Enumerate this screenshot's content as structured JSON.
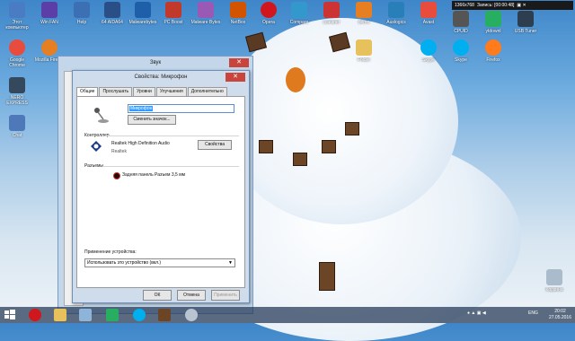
{
  "desktop_icons": [
    {
      "label": "Этот компьютер",
      "color": "#4a7cc4"
    },
    {
      "label": "Win FAN",
      "color": "#5b3ea8"
    },
    {
      "label": "Help",
      "color": "#3d6fb5"
    },
    {
      "label": "64 AIDA64",
      "color": "#2a4f86"
    },
    {
      "label": "Malwarebytes",
      "color": "#1f5ea8"
    },
    {
      "label": "PC Boost",
      "color": "#c0392b"
    },
    {
      "label": "Malware Bytes",
      "color": "#9b59b6"
    },
    {
      "label": "NetBox",
      "color": "#d35400"
    },
    {
      "label": "Opera",
      "color": "#d1171e"
    },
    {
      "label": "Compare",
      "color": "#3399cc"
    },
    {
      "label": "ccleaner",
      "color": "#cc3333"
    },
    {
      "label": "demo",
      "color": "#e67e22"
    },
    {
      "label": "Auslogics",
      "color": "#2980b9"
    },
    {
      "label": "Avast",
      "color": "#e74c3c"
    },
    {
      "label": "CPUID",
      "color": "#555555"
    },
    {
      "label": "ytdownl",
      "color": "#27ae60"
    },
    {
      "label": "USB Tuner",
      "color": "#2c3e50"
    },
    {
      "label": "Google Chrome",
      "color": "#e74c3c"
    },
    {
      "label": "Mozilla Firefox",
      "color": "#e67e22"
    },
    {
      "label": "NERO EXPRESS",
      "color": "#34495e"
    },
    {
      "label": "Chat",
      "color": "#4f78b8"
    },
    {
      "label": "Skype",
      "color": "#00aff0"
    },
    {
      "label": "Skype",
      "color": "#00aff0"
    },
    {
      "label": "Folder",
      "color": "#e6c15c"
    },
    {
      "label": "Firefox",
      "color": "#ff7b1c"
    },
    {
      "label": "Корзина",
      "color": "#aabbcc"
    }
  ],
  "recording": {
    "resolution": "1366x768",
    "status": "Запись: [00:00:48]"
  },
  "bg_window": {
    "title": "Звук",
    "close": "✕"
  },
  "dialog": {
    "title": "Свойства: Микрофон",
    "close": "✕",
    "tabs": [
      "Общие",
      "Прослушать",
      "Уровни",
      "Улучшения",
      "Дополнительно"
    ],
    "name_value": "Микрофон",
    "change_icon_button": "Сменить значок...",
    "controller_label": "Контроллер",
    "controller_name": "Realtek High Definition Audio",
    "controller_vendor": "Realtek",
    "properties_button": "Свойства",
    "jacks_label": "Разъемы",
    "jack_item": "Задняя панель Разъем 3,5 мм",
    "usage_label": "Применение устройства:",
    "usage_value": "Использовать это устройство (вкл.)",
    "ok_button": "ОК",
    "cancel_button": "Отмена",
    "apply_button": "Применить"
  },
  "taskbar": {
    "lang": "ENG",
    "time": "20:02",
    "date": "27.05.2016"
  }
}
